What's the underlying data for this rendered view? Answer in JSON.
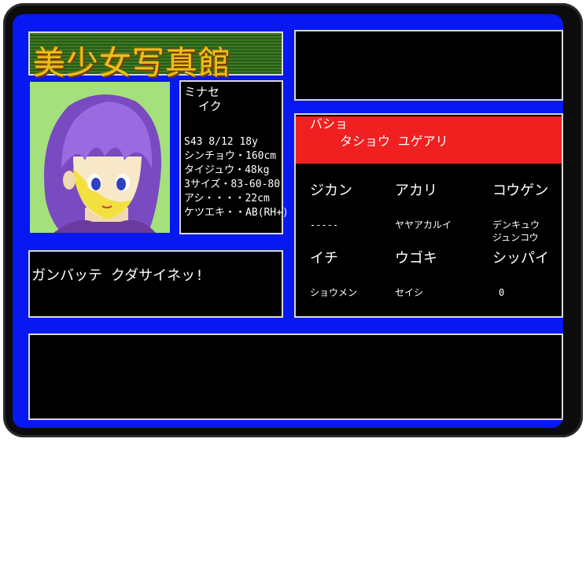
{
  "game": {
    "title": "美少女写真館",
    "character": {
      "name_line1": "ミナセ",
      "name_line2": "イク",
      "birth": "S43 8/12 18y",
      "height": "シンチョウ・160cm",
      "weight": "タイジュウ・48kg",
      "three_sizes": "3サイズ・83-60-80",
      "foot": "アシ・・・・22cm",
      "blood": "ケツエキ・・AB(RH+)"
    },
    "message": "ガンバッテ クダサイネッ!",
    "location": {
      "label": "バショ",
      "value": "タショウ ユゲアリ"
    },
    "table": {
      "h1": "ジカン",
      "h2": "アカリ",
      "h3": "コウゲン",
      "v1": "-----",
      "v2": "ヤヤアカルイ",
      "v3a": "デンキュウ",
      "v3b": "ジュンコウ",
      "h4": "イチ",
      "h5": "ウゴキ",
      "h6": "シッパイ",
      "v4": "ショウメン",
      "v5": "セイシ",
      "v6": "0"
    },
    "colors": {
      "screen_bg": "#0818f0",
      "title_text": "#e9c21a",
      "location_bar": "#f02020",
      "portrait_bg": "#a4e07c",
      "hair": "#8a5ad0"
    }
  }
}
